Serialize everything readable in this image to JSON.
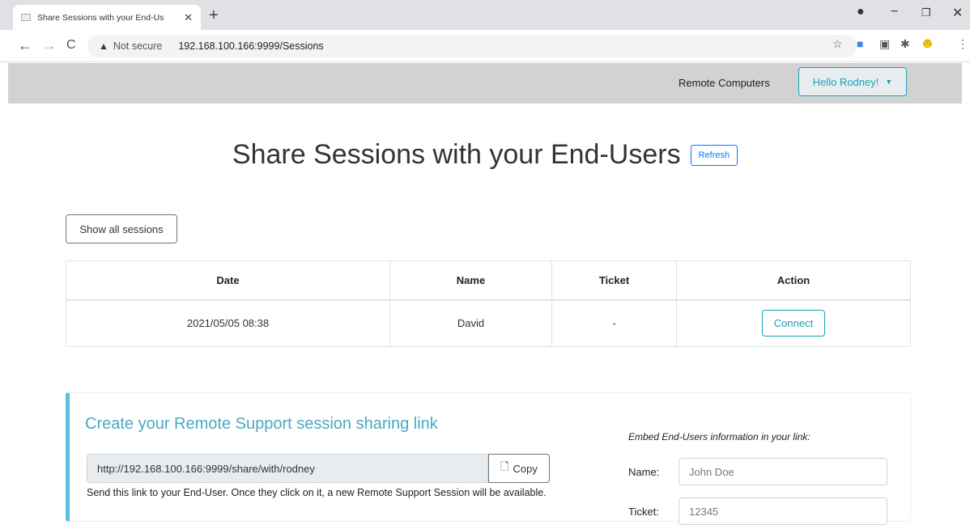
{
  "browser": {
    "tab_title": "Share Sessions with your End-Us",
    "new_tab": "+",
    "not_secure": "Not secure",
    "url": "192.168.100.166:9999/Sessions",
    "window_controls": [
      "minimize-icon",
      "maximize-icon",
      "close-icon"
    ]
  },
  "navbar": {
    "remote_computers": "Remote Computers",
    "user_menu": "Hello Rodney!"
  },
  "page": {
    "title": "Share Sessions with your End-Users",
    "refresh_label": "Refresh",
    "show_all_label": "Show all sessions"
  },
  "sessions_table": {
    "headers": [
      "Date",
      "Name",
      "Ticket",
      "Action"
    ],
    "rows": [
      {
        "date": "2021/05/05 08:38",
        "name": "David",
        "ticket": "-",
        "action": "Connect"
      }
    ]
  },
  "share_panel": {
    "title": "Create your Remote Support session sharing link",
    "link": "http://192.168.100.166:9999/share/with/rodney",
    "copy_label": "Copy",
    "help_text": "Send this link to your End-User. Once they click on it, a new Remote Support Session will be available.",
    "embed_title": "Embed End-Users information in your link:",
    "name_label": "Name:",
    "name_placeholder": "John Doe",
    "ticket_label": "Ticket:",
    "ticket_placeholder": "12345"
  },
  "colors": {
    "info": "#17a2b8",
    "primary": "#007bff",
    "callout_border": "#5bc0de",
    "navbar_bg": "#d2d2d2"
  }
}
